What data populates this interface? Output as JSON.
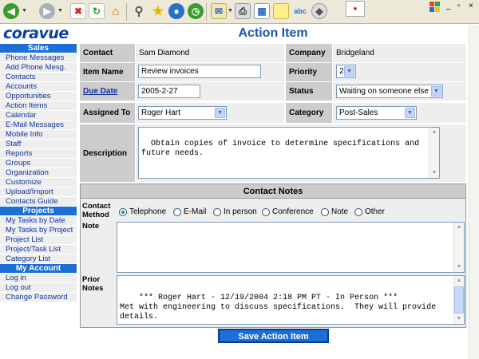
{
  "browser": {
    "toolbar_icons": [
      "back-icon",
      "forward-icon",
      "stop-icon",
      "refresh-icon",
      "home-icon",
      "search-icon",
      "favorites-icon",
      "media-icon",
      "history-icon",
      "mail-icon",
      "print-icon",
      "edit-icon",
      "discuss-icon",
      "spelling-icon",
      "messenger-icon"
    ],
    "window_controls": [
      "_",
      "▫",
      "×"
    ]
  },
  "logo": "coravue",
  "sidebar": {
    "sections": [
      {
        "title": "Sales",
        "items": [
          "Phone Messages",
          "Add Phone Mesg.",
          "Contacts",
          "Accounts",
          "Opportunities",
          "Action Items",
          "Calendar",
          "E-Mail Messages",
          "Mobile Info",
          "Staff",
          "Reports",
          "Groups",
          "Organization",
          "Customize",
          "Upload/Import",
          "Contacts Guide"
        ]
      },
      {
        "title": "Projects",
        "items": [
          "My Tasks by Date",
          "My Tasks by Project",
          "Project List",
          "Project/Task List",
          "Category List"
        ]
      },
      {
        "title": "My Account",
        "items": [
          "Log in",
          "Log out",
          "Change Password"
        ]
      }
    ]
  },
  "form": {
    "title": "Action Item",
    "contact_label": "Contact",
    "contact_value": "Sam Diamond",
    "company_label": "Company",
    "company_value": "Bridgeland",
    "item_name_label": "Item Name",
    "item_name_value": "Review invoices",
    "priority_label": "Priority",
    "priority_value": "2",
    "due_date_label": "Due Date",
    "due_date_value": "2005-2-27",
    "status_label": "Status",
    "status_value": "Waiting on someone else",
    "assigned_to_label": "Assigned To",
    "assigned_to_value": "Roger Hart",
    "category_label": "Category",
    "category_value": "Post-Sales",
    "description_label": "Description",
    "description_value": "Obtain copies of invoice to determine specifications and\nfuture needs."
  },
  "notes": {
    "title": "Contact Notes",
    "method_label": "Contact Method",
    "methods": [
      "Telephone",
      "E-Mail",
      "In person",
      "Conference",
      "Note",
      "Other"
    ],
    "selected_method": "Telephone",
    "note_label": "Note",
    "note_value": "",
    "prior_label": "Prior Notes",
    "prior_value": "*** Roger Hart - 12/19/2004 2:18 PM PT - In Person ***\nMet with engineering to discuss specifications.  They will provide\ndetails."
  },
  "save_button": "Save Action Item",
  "colors": {
    "accent": "#1b6fd6",
    "title": "#1b53b0",
    "link": "#1133a0",
    "label_bg": "#cccccc",
    "value_bg": "#eeeeee"
  }
}
